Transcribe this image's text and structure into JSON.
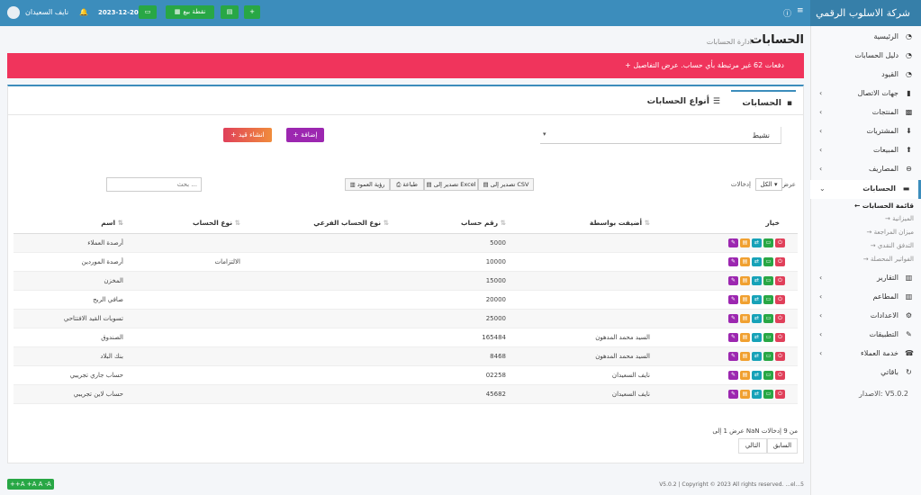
{
  "brand": "شركة الاسلوب الرقمي",
  "topbar": {
    "user_name": "نايف السعيدان",
    "date": "2023-12-20",
    "pos_label": "نقطة بيع"
  },
  "sidebar": {
    "items": [
      {
        "label": "الرئيسية",
        "icon": "gauge-icon"
      },
      {
        "label": "دليل الحسابات",
        "icon": "gauge-icon"
      },
      {
        "label": "القيود",
        "icon": "gauge-icon"
      },
      {
        "label": "جهات الاتصال",
        "icon": "address-book-icon"
      },
      {
        "label": "المنتجات",
        "icon": "cubes-icon"
      },
      {
        "label": "المشتريات",
        "icon": "download-icon"
      },
      {
        "label": "المبيعات",
        "icon": "upload-icon"
      },
      {
        "label": "المصاريف",
        "icon": "minus-circle-icon"
      },
      {
        "label": "الحسابات",
        "icon": "money-icon"
      }
    ],
    "sub_items": [
      "قائمة الحسابات",
      "الميزانية",
      "ميزان المراجعة",
      "التدفق النقدي",
      "الفواتير المحصلة"
    ],
    "items_after": [
      {
        "label": "التقارير",
        "icon": "chart-icon"
      },
      {
        "label": "المطاعم",
        "icon": "utensils-icon"
      },
      {
        "label": "الاعدادات",
        "icon": "gear-icon"
      },
      {
        "label": "التطبيقات",
        "icon": "apps-icon"
      },
      {
        "label": "خدمة العملاء",
        "icon": "support-icon"
      },
      {
        "label": "باقاتي",
        "icon": "sync-icon"
      }
    ],
    "version_label": "الاصدار:",
    "version_value": "V5.0.2"
  },
  "page": {
    "title": "الحسابات",
    "subtitle": "ادارة الحسابات"
  },
  "alert": "+ دفعات 62 غير مرتبطة بأي حساب. عرض التفاصيل",
  "tabs": [
    "الحسابات",
    "أنواع الحسابات"
  ],
  "filter": {
    "status_value": "نشيط"
  },
  "buttons": {
    "add": "إضافة",
    "create_entry": "انشاء قيد"
  },
  "table_tools": {
    "show_label": "عرض",
    "length_value": "الكل",
    "entries_label": "إدخالات",
    "export_csv": "تصدير إلى CSV",
    "export_excel": "تصدير إلى Excel",
    "print": "طباعة",
    "column_visibility": "رؤية العمود",
    "search_placeholder": "بحث ..."
  },
  "table": {
    "headers": [
      "اسم",
      "نوع الحساب",
      "نوع الحساب الفرعي",
      "رقم حساب",
      "أضيفت بواسطة",
      "خيار"
    ],
    "rows": [
      {
        "name": "أرصدة العملاء",
        "type": "",
        "subtype": "",
        "number": "5000",
        "added_by": ""
      },
      {
        "name": "أرصدة الموردين",
        "type": "الالتزامات",
        "subtype": "",
        "number": "10000",
        "added_by": ""
      },
      {
        "name": "المخزن",
        "type": "",
        "subtype": "",
        "number": "15000",
        "added_by": ""
      },
      {
        "name": "صافي الربح",
        "type": "",
        "subtype": "",
        "number": "20000",
        "added_by": ""
      },
      {
        "name": "تسويات القيد الافتتاحي",
        "type": "",
        "subtype": "",
        "number": "25000",
        "added_by": ""
      },
      {
        "name": "الصندوق",
        "type": "",
        "subtype": "",
        "number": "165484",
        "added_by": "السيد محمد المدهون"
      },
      {
        "name": "بنك البلاد",
        "type": "",
        "subtype": "",
        "number": "8468",
        "added_by": "السيد محمد المدهون"
      },
      {
        "name": "حساب جاري تجريبي",
        "type": "",
        "subtype": "",
        "number": "02258",
        "added_by": "نايف السعيدان"
      },
      {
        "name": "حساب لاين تجريبي",
        "type": "",
        "subtype": "",
        "number": "45682",
        "added_by": "نايف السعيدان"
      }
    ]
  },
  "pagination": {
    "info": "عرض 1 إلى NaN من 9 إدخالات",
    "prev": "السابق",
    "next": "التالي"
  },
  "footer": {
    "copyright": "V5.0.2 | Copyright © 2023 All rights reserved. ...el...5",
    "font_controls": [
      "++A",
      "+A",
      "A",
      "-A"
    ]
  },
  "colors": {
    "primary": "#3c8dbc",
    "success": "#28a745",
    "danger": "#f0345c",
    "purple": "#9c27b0"
  }
}
